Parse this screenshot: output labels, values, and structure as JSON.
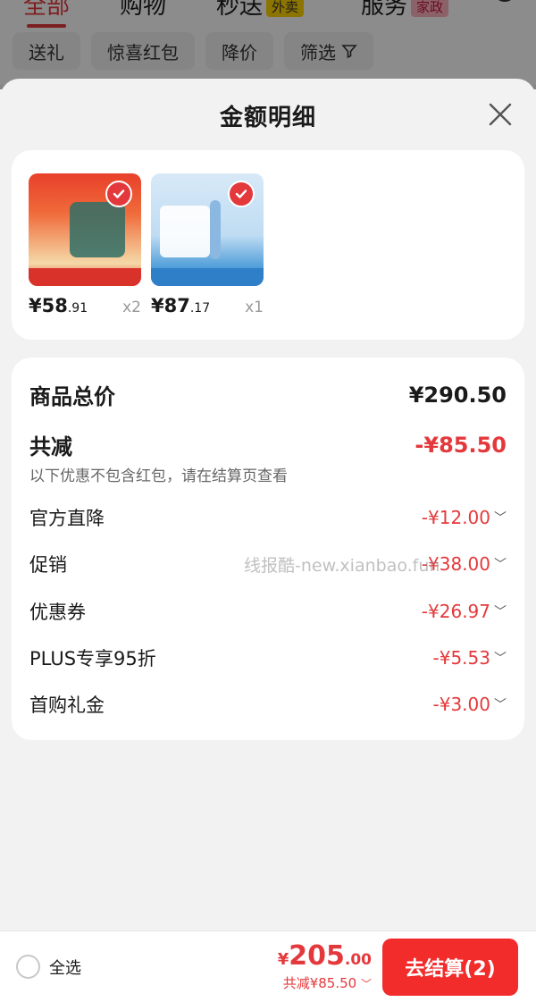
{
  "background": {
    "tabs": [
      "全部",
      "购物",
      "秒送",
      "服务"
    ],
    "tab_badges": {
      "miaosong": "外卖",
      "fuwu": "家政"
    },
    "filters": [
      "送礼",
      "惊喜红包",
      "降价",
      "筛选"
    ]
  },
  "sheet": {
    "title": "金额明细",
    "products": [
      {
        "price_int": "¥58",
        "price_dec": ".91",
        "qty": "x2",
        "color_top": "#e8402a",
        "color_bottom": "#f5d9a8"
      },
      {
        "price_int": "¥87",
        "price_dec": ".17",
        "qty": "x1",
        "color_top": "#d8e9f7",
        "color_bottom": "#4a9bd8"
      }
    ],
    "summary": {
      "total_label": "商品总价",
      "total_value": "¥290.50",
      "reduce_label": "共减",
      "reduce_value": "-¥85.50",
      "note": "以下优惠不包含红包，请在结算页查看"
    },
    "discounts": [
      {
        "label": "官方直降",
        "value": "-¥12.00"
      },
      {
        "label": "促销",
        "value": "-¥38.00"
      },
      {
        "label": "优惠券",
        "value": "-¥26.97"
      },
      {
        "label": "PLUS专享95折",
        "value": "-¥5.53"
      },
      {
        "label": "首购礼金",
        "value": "-¥3.00"
      }
    ],
    "watermark": "线报酷-new.xianbao.fun"
  },
  "bottom_bar": {
    "select_all": "全选",
    "price_currency": "¥",
    "price_int": "205",
    "price_dec": ".00",
    "reduce_text": "共减¥85.50",
    "checkout_label": "去结算(2)"
  },
  "colors": {
    "accent": "#e4393c",
    "button": "#f22b2b"
  },
  "icons": [
    "close-icon",
    "check-icon",
    "chevron-down-icon",
    "search-icon",
    "filter-icon"
  ]
}
